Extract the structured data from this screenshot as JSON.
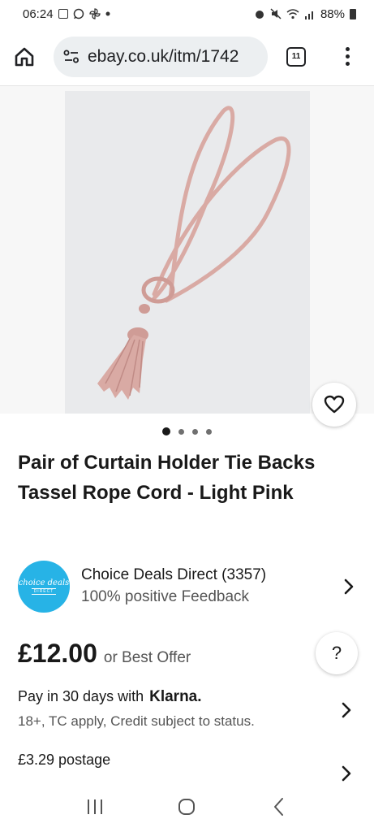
{
  "status_bar": {
    "time": "06:24",
    "left_icons": [
      "gallery-icon",
      "whatsapp-icon",
      "pinwheel-icon",
      "dot-icon"
    ],
    "right_icons": [
      "alarm-icon",
      "mute-icon",
      "wifi-icon",
      "signal-icon"
    ],
    "battery": "88%"
  },
  "browser": {
    "url": "ebay.co.uk/itm/1742",
    "tab_count": "11"
  },
  "gallery": {
    "photo_description_icon": "product-photo",
    "page_count": 4,
    "active_page": 1
  },
  "listing": {
    "title": "Pair of Curtain Holder Tie Backs Tassel Rope Cord - Light Pink"
  },
  "seller": {
    "logo_text_top": "choice deals",
    "logo_text_bottom": "DIRECT",
    "name": "Choice Deals Direct (3357)",
    "feedback": "100% positive Feedback"
  },
  "price": {
    "amount": "£12.00",
    "offer_text": "or Best Offer",
    "help_label": "?"
  },
  "klarna": {
    "line_prefix": "Pay in 30 days with",
    "brand": "Klarna.",
    "terms": "18+, TC apply, Credit subject to status."
  },
  "postage": {
    "text": "£3.29 postage"
  },
  "colors": {
    "seller_logo_bg": "#27b3e6",
    "tassel_pink": "#d9aaa4"
  }
}
